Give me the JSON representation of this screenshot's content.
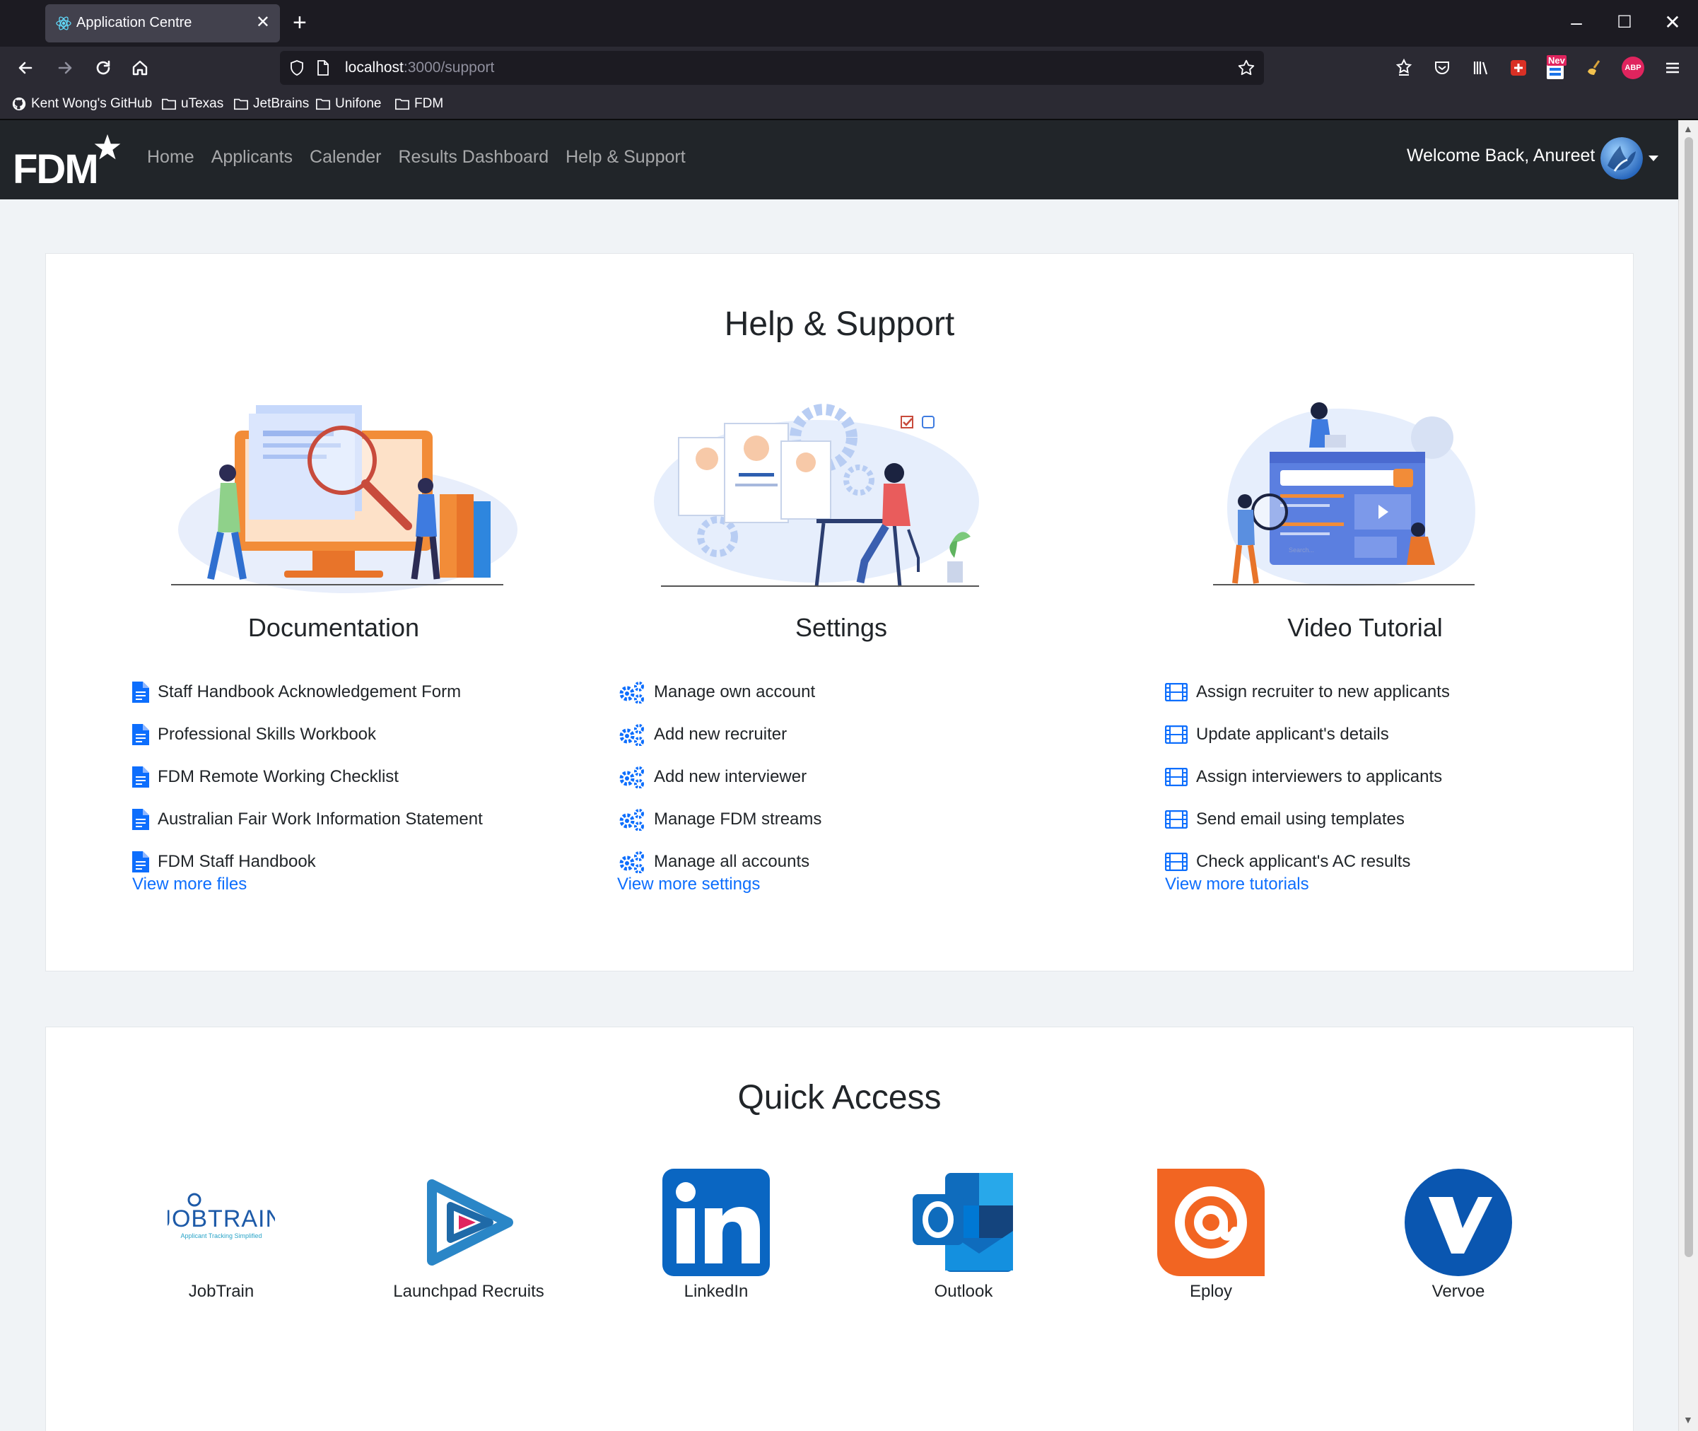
{
  "browser": {
    "tab_title": "Application Centre",
    "url_host": "localhost",
    "url_path": ":3000/support",
    "bookmarks": [
      "Kent Wong's GitHub",
      "uTexas",
      "JetBrains",
      "Unifone",
      "FDM"
    ],
    "badge_new": "Nev",
    "badge_abp": "ABP"
  },
  "app": {
    "logo_text": "FDM",
    "nav": [
      "Home",
      "Applicants",
      "Calender",
      "Results Dashboard",
      "Help & Support"
    ],
    "welcome": "Welcome Back, Anureet"
  },
  "help": {
    "title": "Help & Support",
    "documentation": {
      "heading": "Documentation",
      "items": [
        "Staff Handbook Acknowledgement Form",
        "Professional Skills Workbook",
        "FDM Remote Working Checklist",
        "Australian Fair Work Information Statement",
        "FDM Staff Handbook"
      ],
      "more": "View more files"
    },
    "settings": {
      "heading": "Settings",
      "items": [
        "Manage own account",
        "Add new recruiter",
        "Add new interviewer",
        "Manage FDM streams",
        "Manage all accounts"
      ],
      "more": "View more settings"
    },
    "videos": {
      "heading": "Video Tutorial",
      "items": [
        "Assign recruiter to new applicants",
        "Update applicant's details",
        "Assign interviewers to applicants",
        "Send email using templates",
        "Check applicant's AC results"
      ],
      "more": "View more tutorials",
      "search_placeholder": "Search..."
    }
  },
  "quick": {
    "title": "Quick Access",
    "items": [
      "JobTrain",
      "Launchpad Recruits",
      "LinkedIn",
      "Outlook",
      "Eploy",
      "Vervoe"
    ],
    "jobtrain_wordmark": "JOBTRAIN",
    "jobtrain_tagline": "Applicant Tracking Simplified"
  },
  "colors": {
    "accent": "#0d6efd",
    "navbar": "#212529",
    "linkedin": "#0a66c2",
    "outlook": "#0f6cbd",
    "eploy": "#f26522",
    "vervoe": "#0a56b0"
  }
}
